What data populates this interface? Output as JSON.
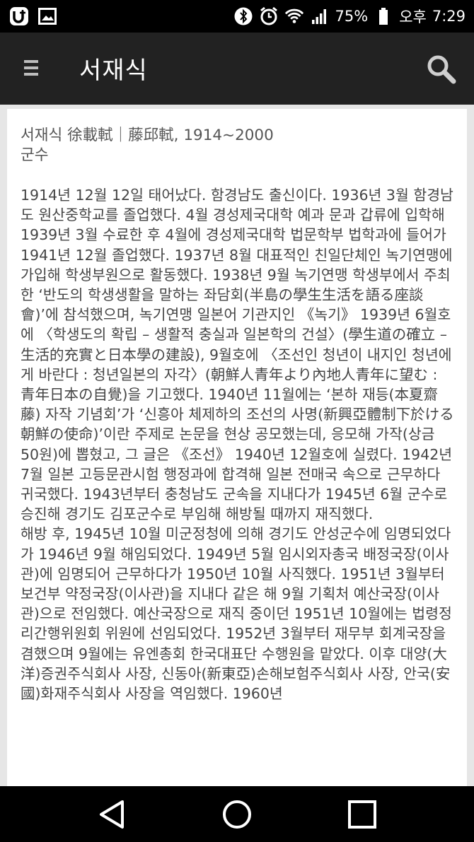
{
  "status_bar": {
    "battery": "75%",
    "ampm": "오후",
    "time": "7:29",
    "icons": [
      "u-plus-icon",
      "gallery-icon",
      "bluetooth-icon",
      "alarm-icon",
      "wifi-icon",
      "signal-icon",
      "battery-icon"
    ]
  },
  "app_bar": {
    "title": "서재식",
    "icons": [
      "menu-icon",
      "search-icon"
    ]
  },
  "entry": {
    "header": "서재식 徐載軾｜藤邱軾, 1914~2000",
    "position": "군수",
    "paragraphs": [
      "1914년 12월 12일 태어났다. 함경남도 출신이다. 1936년 3월 함경남도 원산중학교를 졸업했다. 4월 경성제국대학 예과 문과 갑류에 입학해 1939년 3월 수료한 후 4월에 경성제국대학 법문학부 법학과에 들어가 1941년 12월 졸업했다. 1937년 8월 대표적인 친일단체인 녹기연맹에 가입해 학생부원으로 활동했다. 1938년 9월 녹기연맹 학생부에서 주최한 ‘반도의 학생생활을 말하는 좌담회(半島の學生生活を語る座談會)’에 참석했으며, 녹기연맹 일본어 기관지인 《녹기》 1939년 6월호에 〈학생도의 확립 – 생활적 충실과 일본학의 건설〉(學生道の確立 – 生活的充實と日本學の建設), 9월호에 〈조선인 청년이 내지인 청년에게 바란다 : 청년일본의 자각〉(朝鮮人青年より內地人青年に望む : 青年日本の自覺)을 기고했다. 1940년 11월에는 ‘본하 재등(本夏齋藤) 자작 기념회’가 ‘신흥아 체제하의 조선의 사명(新興亞體制下於ける朝鮮の使命)’이란 주제로 논문을 현상 공모했는데, 응모해 가작(상금 50원)에 뽑혔고, 그 글은 《조선》 1940년 12월호에 실렸다. 1942년 7월 일본 고등문관시험 행정과에 합격해 일본 전매국 속으로 근무하다 귀국했다. 1943년부터 충청남도 군속을 지내다가 1945년 6월 군수로 승진해 경기도 김포군수로 부임해 해방될 때까지 재직했다.",
      "해방 후, 1945년 10월 미군정청에 의해 경기도 안성군수에 임명되었다가 1946년 9월 해임되었다. 1949년 5월 임시외자총국 배정국장(이사관)에 임명되어 근무하다가 1950년 10월 사직했다. 1951년 3월부터 보건부 약정국장(이사관)을 지내다 같은 해 9월 기획처 예산국장(이사관)으로 전임했다. 예산국장으로 재직 중이던 1951년 10월에는 법령정리간행위원회 위원에 선임되었다. 1952년 3월부터 재무부 회계국장을 겸했으며 9월에는 유엔총회 한국대표단 수행원을 맡았다. 이후 대양(大洋)증권주식회사 사장, 신동아(新東亞)손해보험주식회사 사장, 안국(安國)화재주식회사 사장을 역임했다. 1960년"
    ]
  },
  "nav_bar": {
    "icons": [
      "back-icon",
      "home-icon",
      "recents-icon"
    ]
  }
}
